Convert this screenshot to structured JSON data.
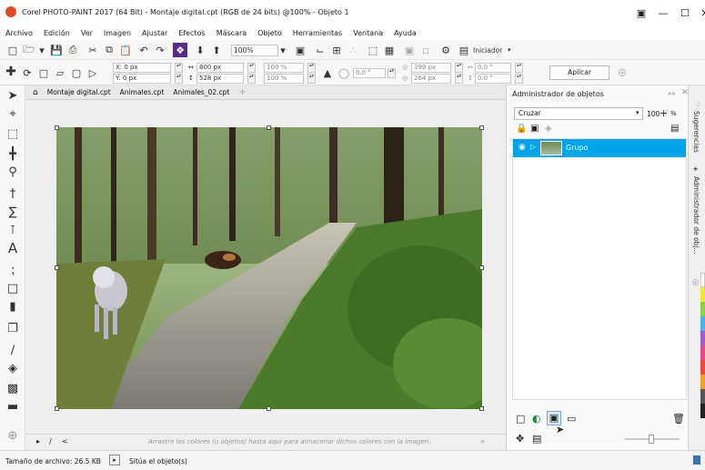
{
  "window": {
    "title": "Corel PHOTO-PAINT 2017 (64 Bit) - Montaje digital.cpt (RGB de 24 bits) @100% - Objeto 1"
  },
  "menu": [
    "Archivo",
    "Edición",
    "Ver",
    "Imagen",
    "Ajustar",
    "Efectos",
    "Máscara",
    "Objeto",
    "Herramientas",
    "Ventana",
    "Ayuda"
  ],
  "toolbar": {
    "zoom": "100%",
    "workspace": "Iniciador"
  },
  "properties": {
    "x": "X: 0 px",
    "y": "Y: 0 px",
    "width": "800 px",
    "height": "528 px",
    "scale_w": "100 %",
    "scale_h": "100 %",
    "angle": "0.0 °",
    "center_x": "399 px",
    "center_y": "264 px",
    "skew_h": "0.0 °",
    "skew_v": "0.0 °",
    "apply_label": "Aplicar"
  },
  "tabs": [
    "Montaje digital.cpt",
    "Animales.cpt",
    "Animales_02.cpt"
  ],
  "docker": {
    "title": "Administrador de objetos",
    "merge_mode": "Cruzar",
    "opacity": "100",
    "opacity_unit": "%",
    "object_name": "Grupo"
  },
  "side_tabs": [
    "Sugerencias",
    "Administrador de obj..."
  ],
  "color_hint": "Arrastre los colores (u objetos) hasta aquí para almacenar dichos colores con la imagen.",
  "status": {
    "file_size": "Tamaño de archivo: 26.5 KB",
    "message": "Sitúa el objeto(s)"
  },
  "colors": {
    "accent": "#00a2e8",
    "app_icon": "#e04b2e"
  }
}
